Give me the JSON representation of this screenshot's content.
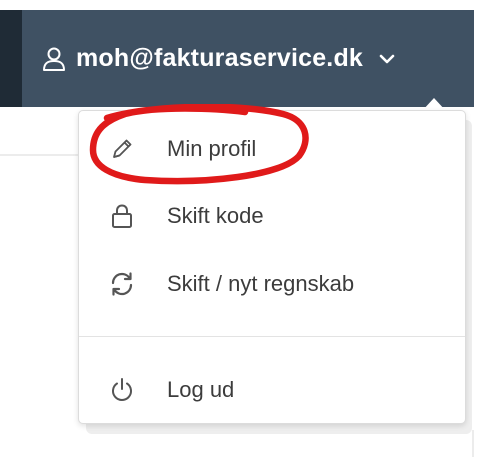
{
  "header": {
    "user_email": "moh@fakturaservice.dk",
    "icons": {
      "user": "user-icon",
      "dropdown": "chevron-down-icon"
    }
  },
  "menu": {
    "items": [
      {
        "label": "Min profil",
        "icon": "pencil-icon"
      },
      {
        "label": "Skift kode",
        "icon": "lock-icon"
      },
      {
        "label": "Skift / nyt regnskab",
        "icon": "refresh-icon"
      },
      {
        "label": "Log ud",
        "icon": "power-icon"
      }
    ]
  },
  "colors": {
    "header_bg": "#3f5163",
    "header_dark": "#1f2b36",
    "highlight_mark": "#e01a1a",
    "text": "#3c3c3c"
  }
}
